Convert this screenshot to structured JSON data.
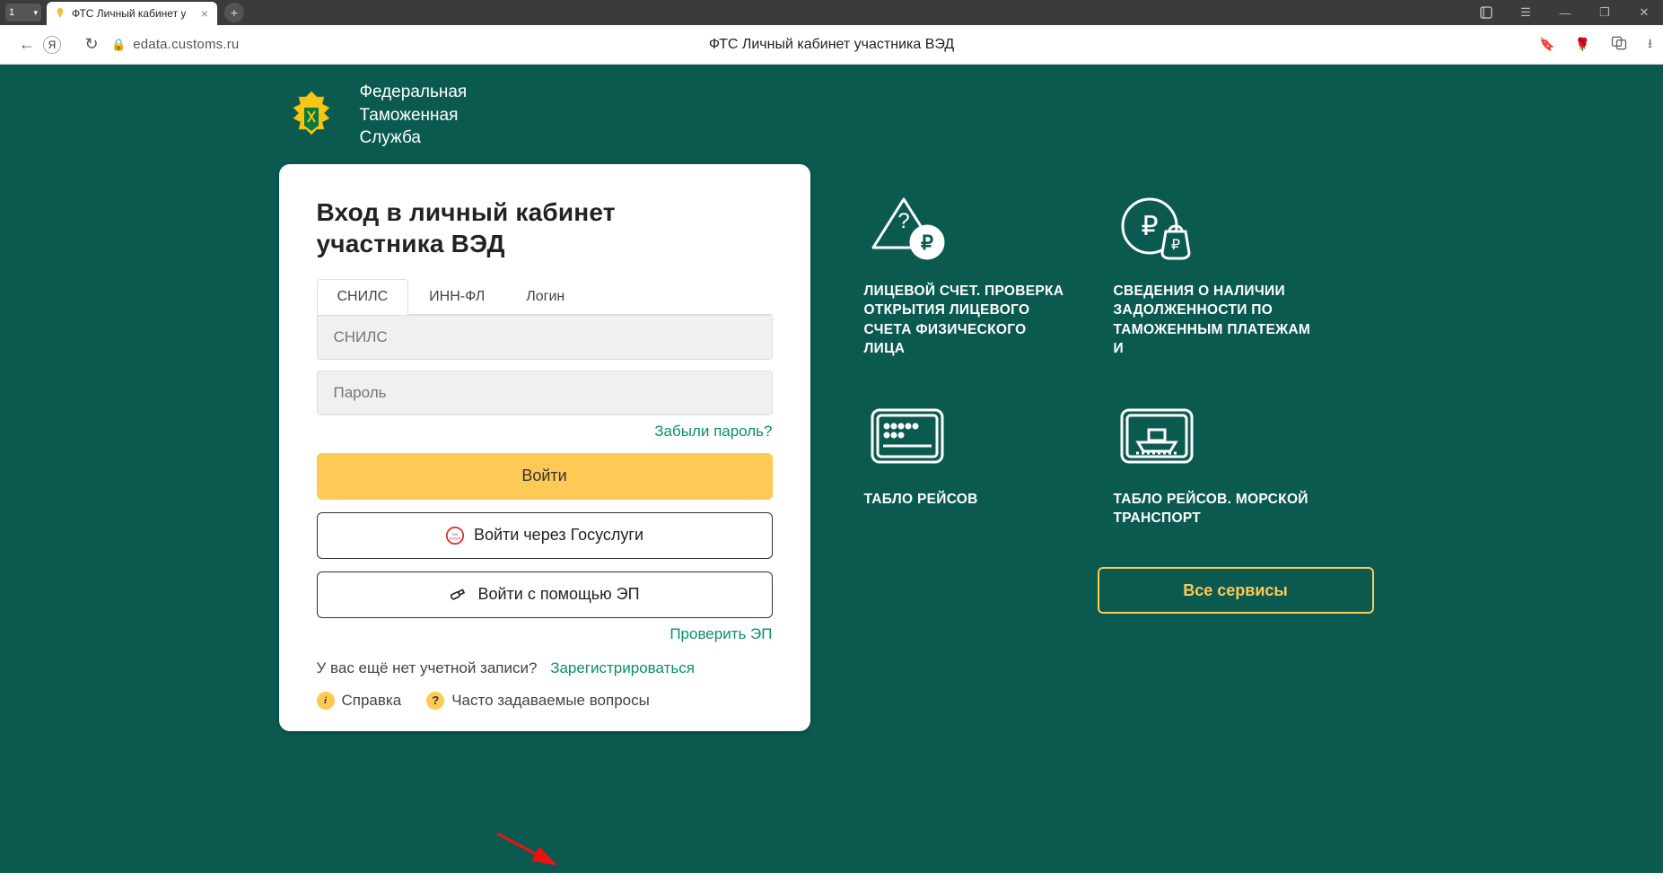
{
  "chrome": {
    "tab_count": "1",
    "tab_title": "ФТС Личный кабинет у",
    "url": "edata.customs.ru",
    "page_title": "ФТС Личный кабинет участника ВЭД"
  },
  "header": {
    "agency_line1": "Федеральная",
    "agency_line2": "Таможенная",
    "agency_line3": "Служба"
  },
  "login": {
    "title_line1": "Вход в личный кабинет",
    "title_line2": "участника ВЭД",
    "tabs": {
      "snils": "СНИЛС",
      "inn": "ИНН-ФЛ",
      "login": "Логин"
    },
    "field_snils_placeholder": "СНИЛС",
    "field_password_placeholder": "Пароль",
    "forgot": "Забыли пароль?",
    "submit": "Войти",
    "gosuslugi": "Войти через Госуслуги",
    "ep": "Войти с помощью ЭП",
    "check_ep": "Проверить ЭП",
    "no_account": "У вас ещё нет учетной записи?",
    "register": "Зарегистрироваться",
    "help_ref": "Справка",
    "help_faq": "Часто задаваемые вопросы"
  },
  "services": {
    "items": [
      {
        "label": "ЛИЦЕВОЙ СЧЕТ. ПРОВЕРКА ОТКРЫТИЯ ЛИЦЕВОГО СЧЕТА ФИЗИЧЕСКОГО ЛИЦА"
      },
      {
        "label": "СВЕДЕНИЯ О НАЛИЧИИ ЗАДОЛЖЕННОСТИ ПО ТАМОЖЕННЫМ ПЛАТЕЖАМ И"
      },
      {
        "label": "ТАБЛО РЕЙСОВ"
      },
      {
        "label": "ТАБЛО РЕЙСОВ. МОРСКОЙ ТРАНСПОРТ"
      }
    ],
    "all": "Все сервисы"
  },
  "colors": {
    "brand_green": "#0a5a50",
    "accent_yellow": "#ffc955",
    "link_green": "#0a8f6b"
  }
}
